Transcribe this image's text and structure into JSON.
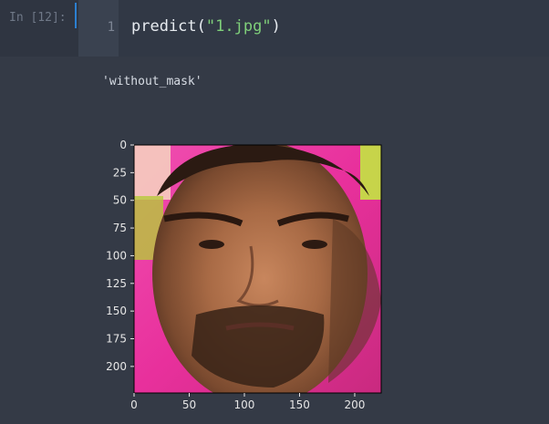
{
  "cell": {
    "prompt": "In [12]:",
    "line_number": "1",
    "code": {
      "fn": "predict",
      "open": "(",
      "arg": "\"1.jpg\"",
      "close": ")"
    }
  },
  "output": {
    "text": "'without_mask'"
  },
  "chart_data": {
    "type": "image",
    "x_ticks": [
      0,
      50,
      100,
      150,
      200
    ],
    "y_ticks": [
      0,
      25,
      50,
      75,
      100,
      125,
      150,
      175,
      200
    ],
    "xlim": [
      0,
      224
    ],
    "ylim": [
      224,
      0
    ]
  },
  "colors": {
    "accent": "#2c7fd0",
    "string": "#7fcf7a",
    "background": "#343a46"
  }
}
